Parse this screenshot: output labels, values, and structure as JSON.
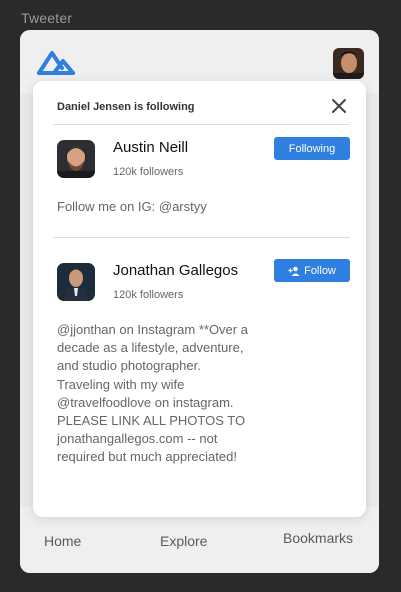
{
  "app": {
    "label": "Tweeter"
  },
  "colors": {
    "accent": "#2f7fe0",
    "logo": "#2f7fe0"
  },
  "header": {
    "logo_icon": "mountain-logo-icon",
    "profile_avatar": "user-avatar-photo"
  },
  "modal": {
    "title": "Daniel Jensen is following",
    "close_icon": "close-icon",
    "users": [
      {
        "name": "Austin Neill",
        "followers": "120k followers",
        "button_label": "Following",
        "bio": "Follow me on IG: @arstyy"
      },
      {
        "name": "Jonathan Gallegos",
        "followers": "120k followers",
        "button_label": "Follow",
        "button_icon": "add-user-icon",
        "bio": "@jjonthan on Instagram **Over a decade as a lifestyle, adventure, and studio photographer. Traveling with my wife @travelfoodlove on instagram. PLEASE LINK ALL PHOTOS TO jonathangallegos.com -- not required but much appreciated!"
      }
    ]
  },
  "nav": {
    "home": "Home",
    "explore": "Explore",
    "bookmarks": "Bookmarks"
  }
}
